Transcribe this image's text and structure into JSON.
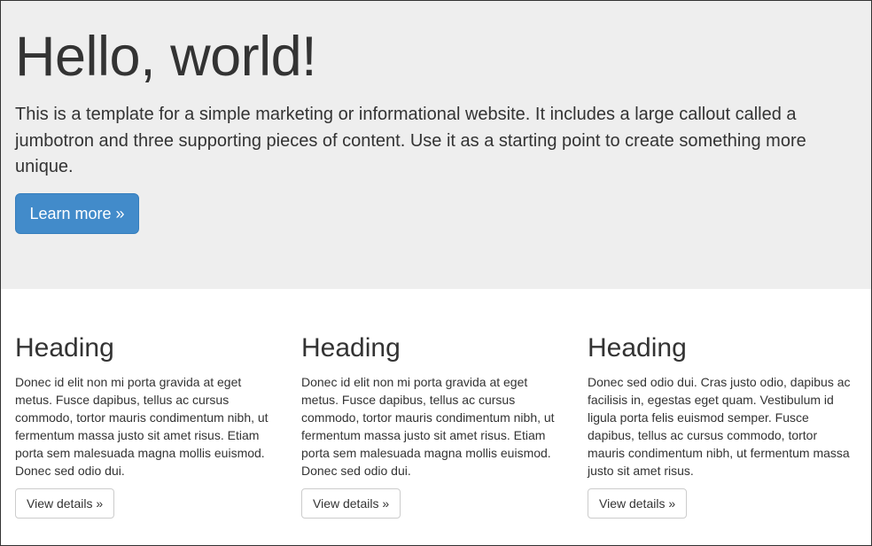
{
  "jumbotron": {
    "title": "Hello, world!",
    "lead": "This is a template for a simple marketing or informational website. It includes a large callout called a jumbotron and three supporting pieces of content. Use it as a starting point to create something more unique.",
    "button_label": "Learn more »"
  },
  "columns": [
    {
      "heading": "Heading",
      "body": "Donec id elit non mi porta gravida at eget metus. Fusce dapibus, tellus ac cursus commodo, tortor mauris condimentum nibh, ut fermentum massa justo sit amet risus. Etiam porta sem malesuada magna mollis euismod. Donec sed odio dui.",
      "button_label": "View details »"
    },
    {
      "heading": "Heading",
      "body": "Donec id elit non mi porta gravida at eget metus. Fusce dapibus, tellus ac cursus commodo, tortor mauris condimentum nibh, ut fermentum massa justo sit amet risus. Etiam porta sem malesuada magna mollis euismod. Donec sed odio dui.",
      "button_label": "View details »"
    },
    {
      "heading": "Heading",
      "body": "Donec sed odio dui. Cras justo odio, dapibus ac facilisis in, egestas eget quam. Vestibulum id ligula porta felis euismod semper. Fusce dapibus, tellus ac cursus commodo, tortor mauris condimentum nibh, ut fermentum massa justo sit amet risus.",
      "button_label": "View details »"
    }
  ],
  "colors": {
    "jumbotron_bg": "#eeeeee",
    "primary": "#428bca",
    "text": "#333333"
  }
}
